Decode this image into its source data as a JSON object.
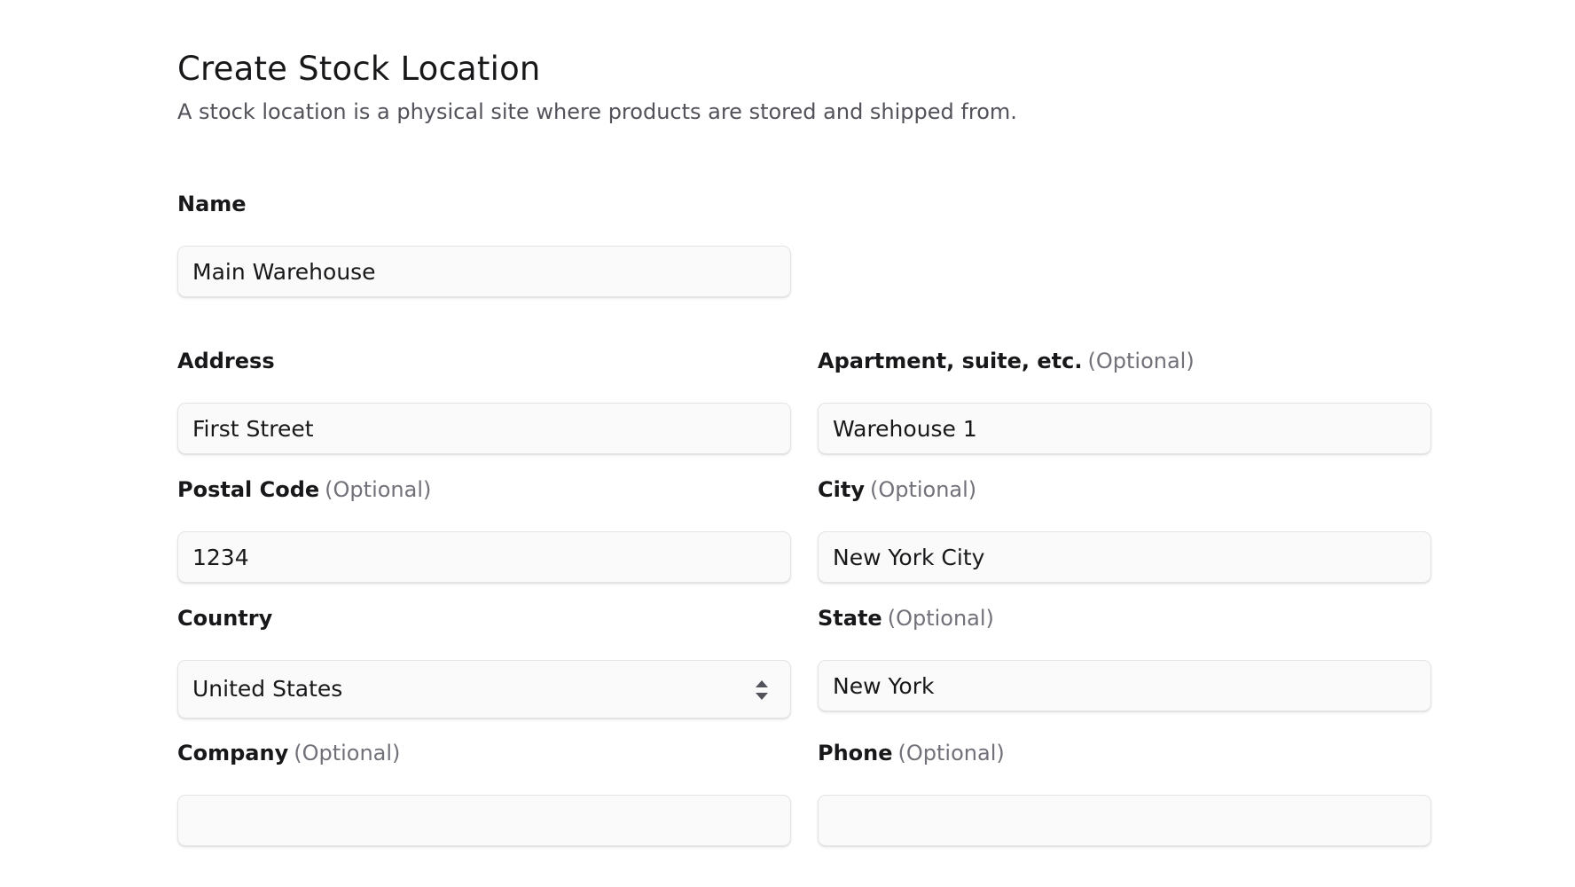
{
  "header": {
    "title": "Create Stock Location",
    "subtitle": "A stock location is a physical site where products are stored and shipped from."
  },
  "form": {
    "optional_tag": "(Optional)",
    "name": {
      "label": "Name",
      "value": "Main Warehouse",
      "placeholder": ""
    },
    "address": {
      "label": "Address",
      "value": "First Street",
      "placeholder": ""
    },
    "apartment": {
      "label": "Apartment, suite, etc.",
      "value": "Warehouse 1",
      "placeholder": ""
    },
    "postal_code": {
      "label": "Postal Code",
      "value": "1234",
      "placeholder": ""
    },
    "city": {
      "label": "City",
      "value": "New York City",
      "placeholder": ""
    },
    "country": {
      "label": "Country",
      "value": "United States"
    },
    "state": {
      "label": "State",
      "value": "New York",
      "placeholder": ""
    },
    "company": {
      "label": "Company",
      "value": "",
      "placeholder": ""
    },
    "phone": {
      "label": "Phone",
      "value": "",
      "placeholder": ""
    }
  },
  "icons": {
    "select_chevron": "chevron-up-down-icon"
  },
  "colors": {
    "text_primary": "#18181b",
    "text_secondary": "#52525b",
    "text_muted": "#71717a",
    "input_bg": "#fafafa",
    "input_border": "#e4e4e7"
  }
}
